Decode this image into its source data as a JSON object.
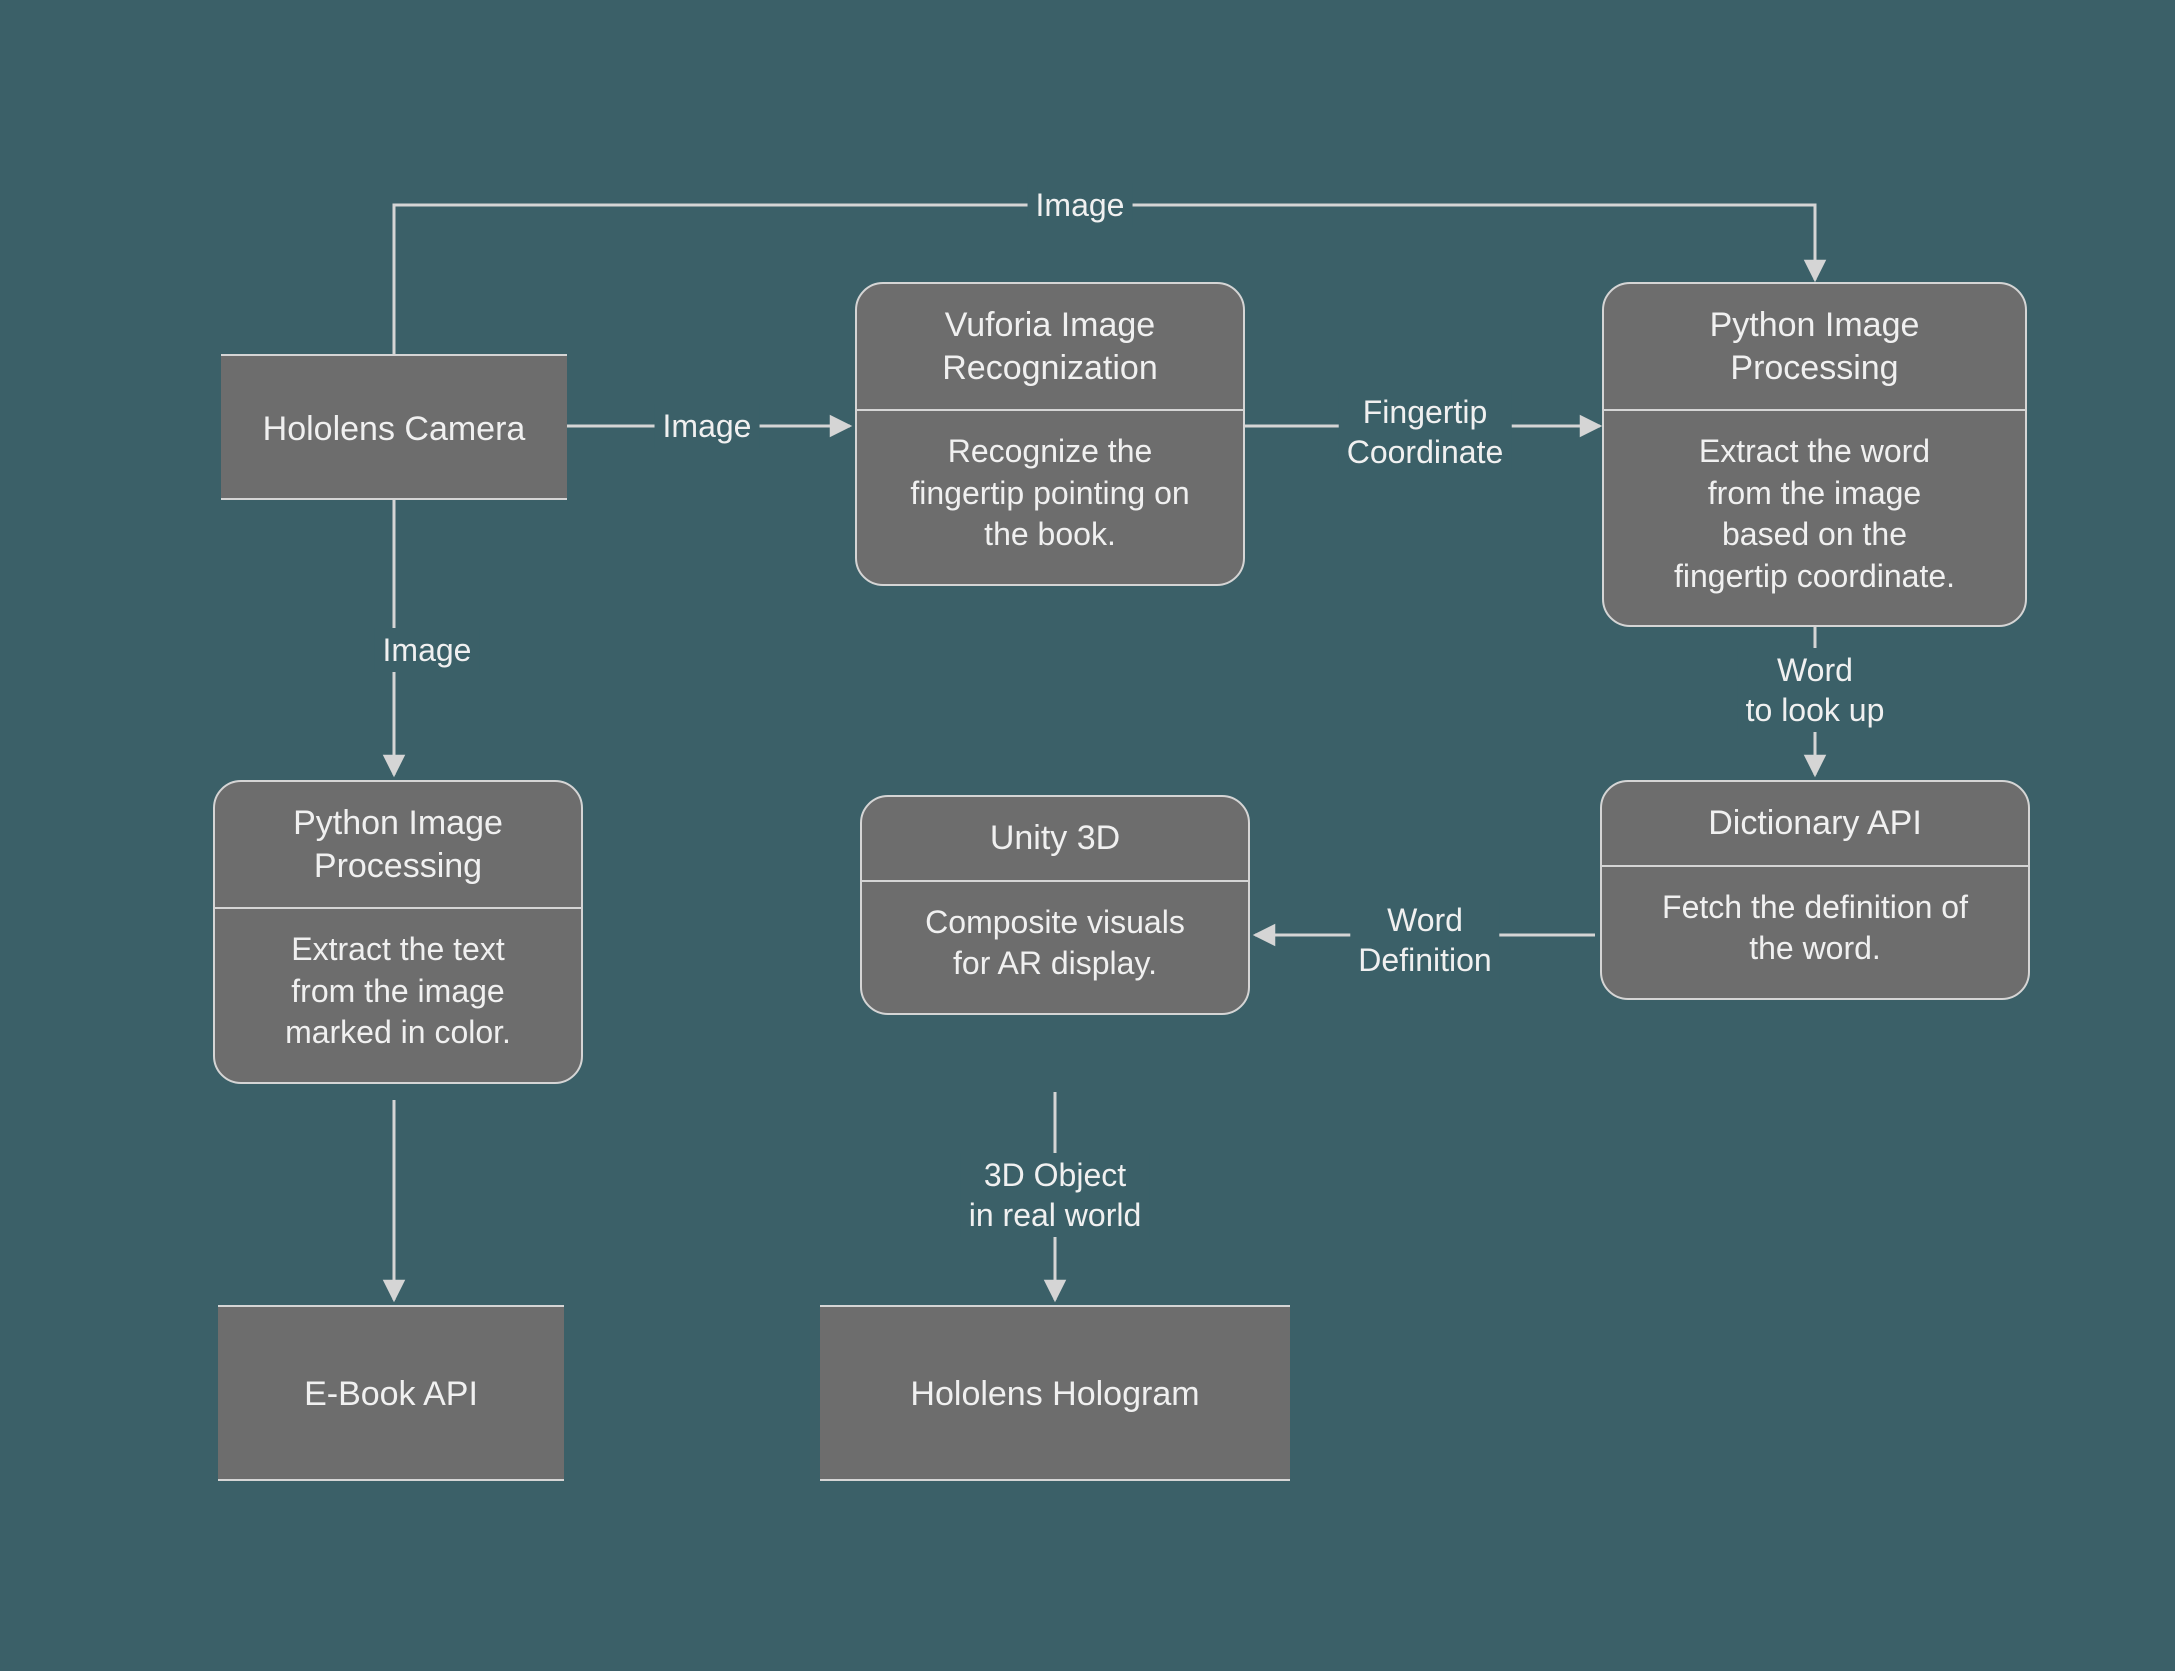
{
  "nodes": {
    "hololens_camera": {
      "title": "Hololens Camera"
    },
    "vuforia": {
      "title": "Vuforia Image\nRecognization",
      "desc": "Recognize the\nfingertip pointing on\nthe book."
    },
    "py_proc_right": {
      "title": "Python Image\nProcessing",
      "desc": "Extract the word\nfrom the image\nbased on the\nfingertip coordinate."
    },
    "py_proc_left": {
      "title": "Python Image\nProcessing",
      "desc": "Extract the text\nfrom the image\nmarked in color."
    },
    "dict_api": {
      "title": "Dictionary API",
      "desc": "Fetch the definition of\nthe word."
    },
    "unity": {
      "title": "Unity 3D",
      "desc": "Composite visuals\nfor AR display."
    },
    "ebook_api": {
      "title": "E-Book API"
    },
    "holo_hologram": {
      "title": "Hololens Hologram"
    }
  },
  "edges": {
    "cam_to_vuforia": "Image",
    "cam_to_py_right_top": "Image",
    "cam_to_py_left": "Image",
    "vuforia_to_py_right": "Fingertip\nCoordinate",
    "py_right_to_dict": "Word\nto look up",
    "dict_to_unity": "Word\nDefinition",
    "unity_to_hologram": "3D Object\nin real world"
  }
}
